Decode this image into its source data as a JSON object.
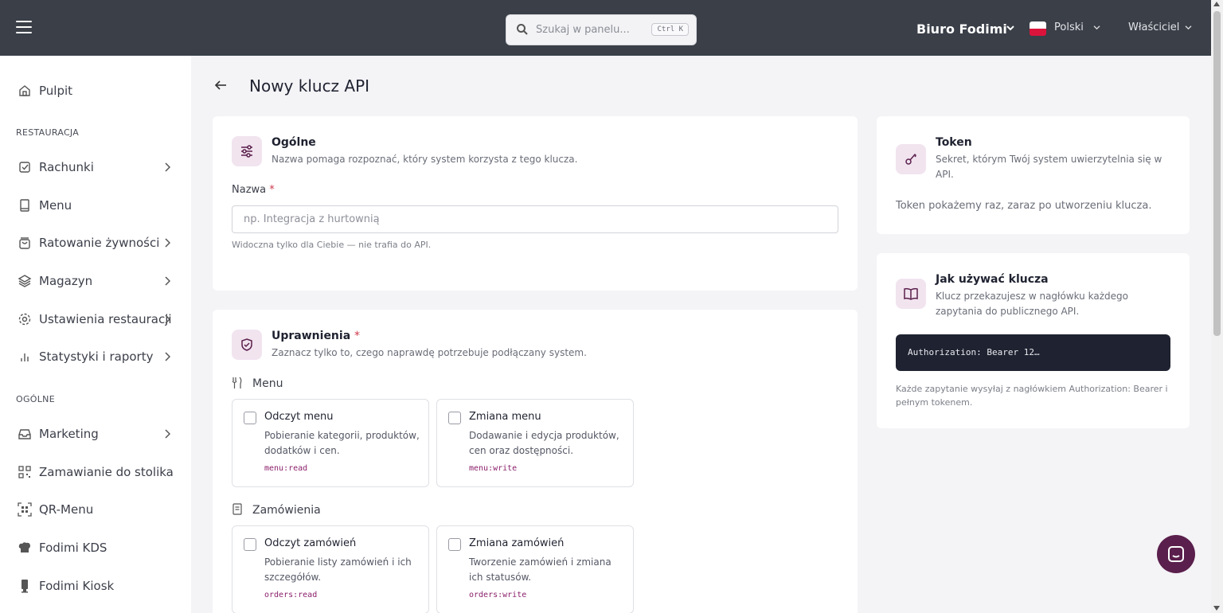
{
  "topbar": {
    "search_placeholder": "Szukaj w panelu...",
    "search_shortcut": "Ctrl K",
    "company": "Biuro Fodimi",
    "language": "Polski",
    "role": "Właściciel"
  },
  "sidebar": {
    "items": [
      {
        "label": "Pulpit",
        "icon": "home-icon"
      },
      {
        "label": "Rachunki",
        "icon": "receipt-check-icon"
      },
      {
        "label": "Menu",
        "icon": "book-icon"
      },
      {
        "label": "Ratowanie żywności",
        "icon": "bag-icon"
      },
      {
        "label": "Magazyn",
        "icon": "layers-icon"
      },
      {
        "label": "Ustawienia restauracji",
        "icon": "gear-icon"
      },
      {
        "label": "Statystyki i raporty",
        "icon": "bar-chart-icon"
      },
      {
        "label": "Marketing",
        "icon": "inbox-icon"
      },
      {
        "label": "Zamawianie do stolika",
        "icon": "qr-grid-icon"
      },
      {
        "label": "QR-Menu",
        "icon": "qr-code-icon"
      },
      {
        "label": "Fodimi KDS",
        "icon": "chef-hat-icon"
      },
      {
        "label": "Fodimi Kiosk",
        "icon": "kiosk-icon"
      }
    ],
    "section_restaurant": "RESTAURACJA",
    "section_general": "OGÓLNE"
  },
  "main": {
    "title": "Nowy klucz API",
    "general": {
      "title": "Ogólne",
      "subtitle": "Nazwa pomaga rozpoznać, który system korzysta z tego klucza.",
      "name_label": "Nazwa",
      "required_mark": "*",
      "name_placeholder": "np. Integracja z hurtownią",
      "name_helper": "Widoczna tylko dla Ciebie — nie trafia do API."
    },
    "permissions": {
      "title": "Uprawnienia",
      "required_mark": "*",
      "subtitle": "Zaznacz tylko to, czego naprawdę potrzebuje podłączany system.",
      "groups": [
        {
          "name": "Menu",
          "items": [
            {
              "title": "Odczyt menu",
              "desc": "Pobieranie kategorii, produktów, dodatków i cen.",
              "scope": "menu:read",
              "checked": false
            },
            {
              "title": "Zmiana menu",
              "desc": "Dodawanie i edycja produktów, cen oraz dostępności.",
              "scope": "menu:write",
              "checked": false
            }
          ]
        },
        {
          "name": "Zamówienia",
          "items": [
            {
              "title": "Odczyt zamówień",
              "desc": "Pobieranie listy zamówień i ich szczegółów.",
              "scope": "orders:read",
              "checked": false
            },
            {
              "title": "Zmiana zamówień",
              "desc": "Tworzenie zamówień i zmiana ich statusów.",
              "scope": "orders:write",
              "checked": false
            }
          ]
        }
      ]
    }
  },
  "aside": {
    "token": {
      "title": "Token",
      "subtitle": "Sekret, którym Twój system uwierzytelnia się w API.",
      "note": "Token pokażemy raz, zaraz po utworzeniu klucza."
    },
    "usage": {
      "title": "Jak używać klucza",
      "subtitle": "Klucz przekazujesz w nagłówku każdego zapytania do publicznego API.",
      "code": "Authorization: Bearer 12…",
      "note": "Każde zapytanie wysyłaj z nagłówkiem Authorization: Bearer i pełnym tokenem."
    }
  },
  "colors": {
    "topbar": "#3a3f48",
    "accent": "#5a1f4c",
    "icon_badge": "#f1e4ef",
    "required": "#d0394c"
  }
}
